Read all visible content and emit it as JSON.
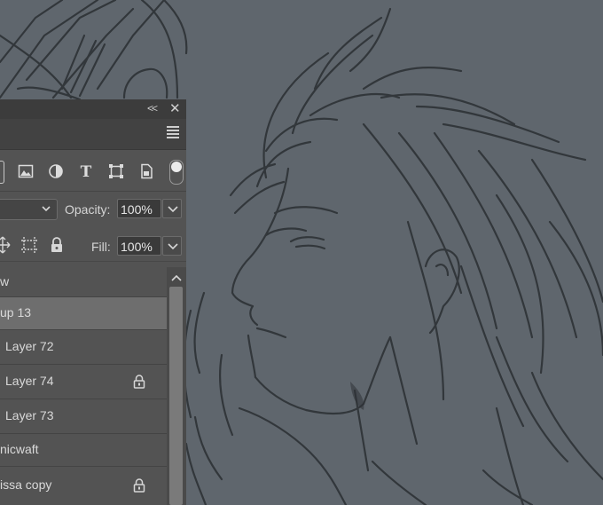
{
  "window": {
    "collapse_glyph": "<<",
    "close_glyph": "✕"
  },
  "icons": {
    "panel_menu": "hamburger-menu-icon",
    "filter_pixel": "image-icon",
    "filter_adjustment": "half-circle-icon",
    "filter_type": "T",
    "filter_shape": "shape-transform-icon",
    "filter_smart": "smart-object-icon",
    "lock_position": "move-icon",
    "lock_artboard": "artboard-icon",
    "lock_all": "lock-icon"
  },
  "controls": {
    "opacity_label": "Opacity:",
    "opacity_value": "100%",
    "fill_label": "Fill:",
    "fill_value": "100%"
  },
  "layers": [
    {
      "name": "w",
      "locked": false,
      "selected": false
    },
    {
      "name": "up 13",
      "locked": false,
      "selected": true
    },
    {
      "name": "Layer 72",
      "locked": false,
      "selected": false
    },
    {
      "name": "Layer 74",
      "locked": true,
      "selected": false
    },
    {
      "name": "Layer 73",
      "locked": false,
      "selected": false
    },
    {
      "name": "nicwaft",
      "locked": false,
      "selected": false
    },
    {
      "name": "issa copy",
      "locked": true,
      "selected": false
    }
  ],
  "colors": {
    "canvas_background": "#5f666d",
    "sketch_stroke": "#2f3337",
    "panel_background": "#535353",
    "selected_layer": "#6e6e6e"
  }
}
